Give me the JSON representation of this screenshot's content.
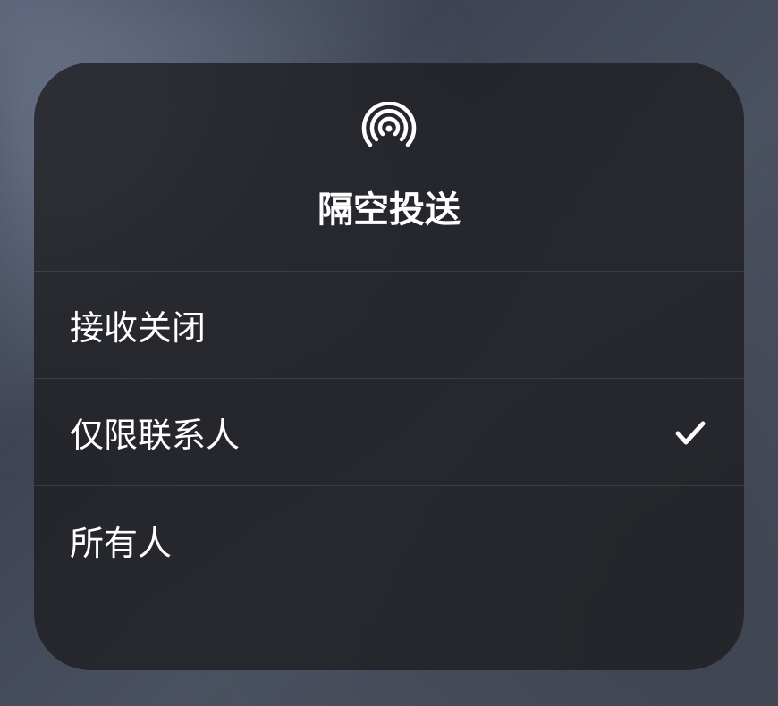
{
  "header": {
    "icon": "airdrop-icon",
    "title": "隔空投送"
  },
  "options": [
    {
      "label": "接收关闭",
      "selected": false
    },
    {
      "label": "仅限联系人",
      "selected": true
    },
    {
      "label": "所有人",
      "selected": false
    }
  ]
}
